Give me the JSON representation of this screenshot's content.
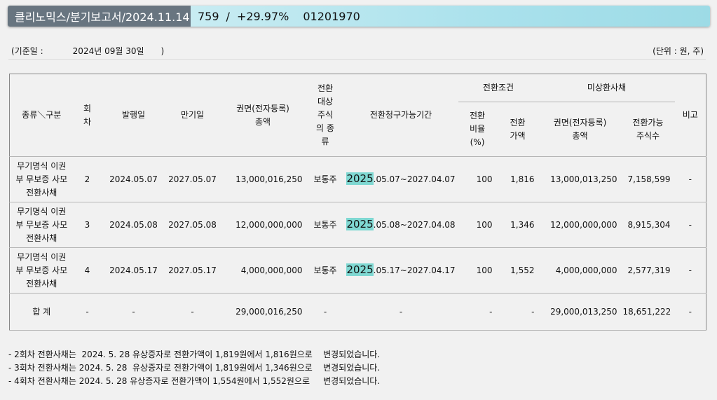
{
  "header": {
    "title": "클리노믹스/분기보고서/2024.11.14",
    "price": "759",
    "separator": "/",
    "change": "+29.97%",
    "code": "01201970"
  },
  "meta": {
    "base_label": "(기준일 :",
    "base_date": "2024년 09월 30일",
    "base_close": ")",
    "unit": "(단위 : 원, 주)"
  },
  "table": {
    "headers": {
      "type": "종류＼구분",
      "round": [
        "회",
        "차"
      ],
      "issue_date": "발행일",
      "maturity": "만기일",
      "face_total": [
        "권면(전자등록)",
        "총액"
      ],
      "target": [
        "전환",
        "대상",
        "주식",
        "의 종",
        "류"
      ],
      "period": "전환청구가능기간",
      "conditions": "전환조건",
      "ratio": [
        "전환",
        "비율",
        "(%)"
      ],
      "conv_price": [
        "전환",
        "가액"
      ],
      "unredeemed": "미상환사채",
      "unredeemed_face": [
        "권면(전자등록)",
        "총액"
      ],
      "convertible_shares": [
        "전환가능",
        "주식수"
      ],
      "remarks": "비고"
    },
    "rows": [
      {
        "type": [
          "무기명식 이권",
          "부 무보증 사모",
          "전환사채"
        ],
        "round": "2",
        "issue_date": "2024.05.07",
        "maturity": "2027.05.07",
        "face_total": "13,000,016,250",
        "target": "보통주",
        "period_hl": "2025",
        "period_rest": ".05.07~2027.04.07",
        "ratio": "100",
        "conv_price": "1,816",
        "unredeemed_face": "13,000,013,250",
        "convertible_shares": "7,158,599",
        "remarks": "-"
      },
      {
        "type": [
          "무기명식 이권",
          "부 무보증 사모",
          "전환사채"
        ],
        "round": "3",
        "issue_date": "2024.05.08",
        "maturity": "2027.05.08",
        "face_total": "12,000,000,000",
        "target": "보통주",
        "period_hl": "2025",
        "period_rest": ".05.08~2027.04.08",
        "ratio": "100",
        "conv_price": "1,346",
        "unredeemed_face": "12,000,000,000",
        "convertible_shares": "8,915,304",
        "remarks": "-"
      },
      {
        "type": [
          "무기명식 이권",
          "부 무보증 사모",
          "전환사채"
        ],
        "round": "4",
        "issue_date": "2024.05.17",
        "maturity": "2027.05.17",
        "face_total": "4,000,000,000",
        "target": "보통주",
        "period_hl": "2025",
        "period_rest": ".05.17~2027.04.17",
        "ratio": "100",
        "conv_price": "1,552",
        "unredeemed_face": "4,000,000,000",
        "convertible_shares": "2,577,319",
        "remarks": "-"
      }
    ],
    "total": {
      "label": "합 계",
      "round": "-",
      "issue_date": "-",
      "maturity": "-",
      "face_total": "29,000,016,250",
      "target": "-",
      "period": "-",
      "ratio": "-",
      "conv_price": "-",
      "unredeemed_face": "29,000,013,250",
      "convertible_shares": "18,651,222",
      "remarks": "-"
    }
  },
  "notes": [
    "- 2회차 전환사채는  2024. 5. 28 유상증자로 전환가액이 1,819원에서 1,816원으로    변경되었습니다.",
    "- 3회차 전환사채는 2024. 5. 28  유상증자로 전환가액이 1,819원에서 1,346원으로    변경되었습니다.",
    "- 4회차 전환사채는 2024. 5. 28 유상증자로 전환가액이 1,554원에서 1,552원으로     변경되었습니다."
  ]
}
